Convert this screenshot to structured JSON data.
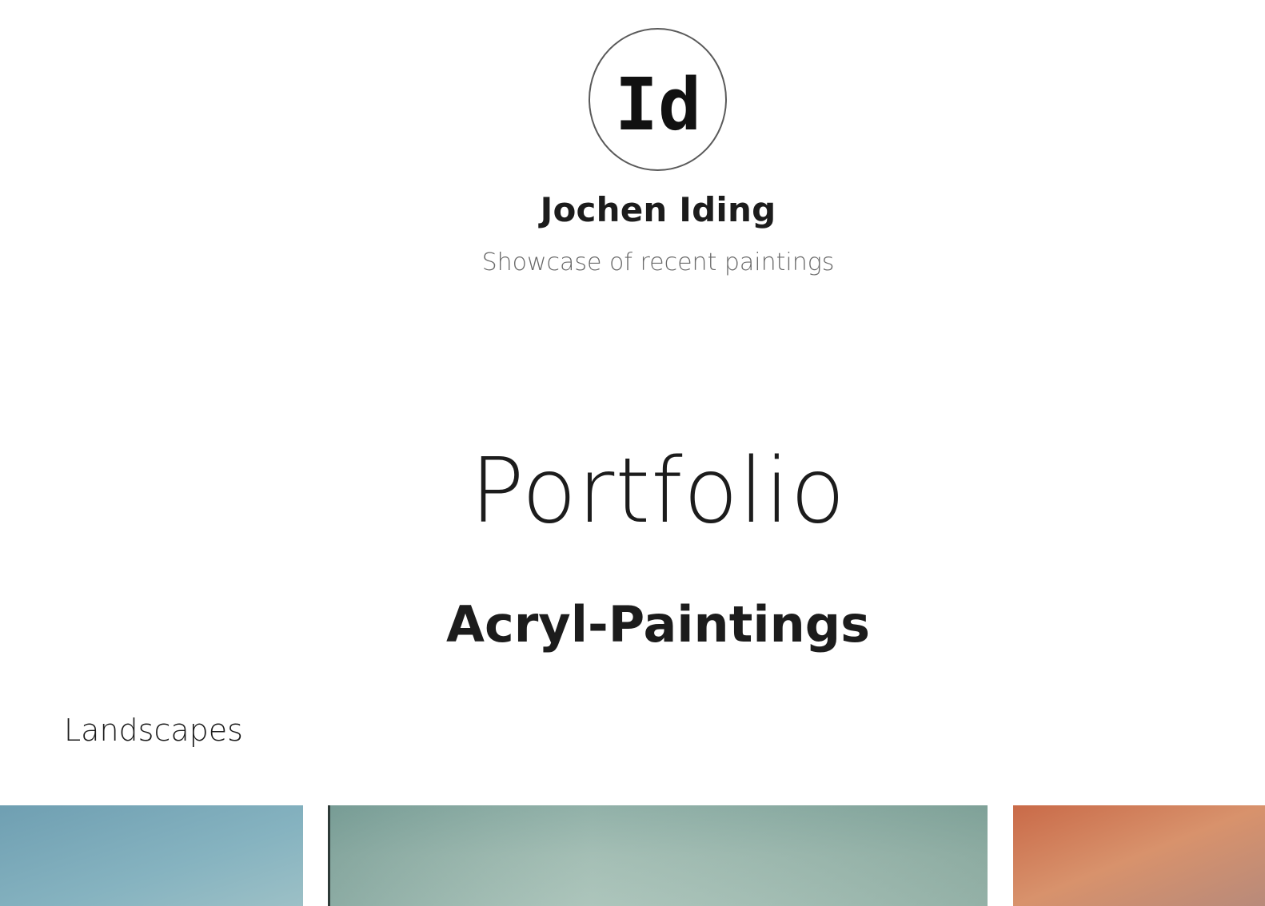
{
  "header": {
    "logo_text": "Id",
    "site_name": "Jochen Iding",
    "tagline": "Showcase of recent paintings"
  },
  "main": {
    "page_title": "Portfolio",
    "section_heading": "Acryl-Paintings",
    "category_label": "Landscapes",
    "gallery": [
      {
        "color": "#7eaab8"
      },
      {
        "color": "#94b0a8"
      },
      {
        "color": "#c9704a"
      }
    ]
  }
}
